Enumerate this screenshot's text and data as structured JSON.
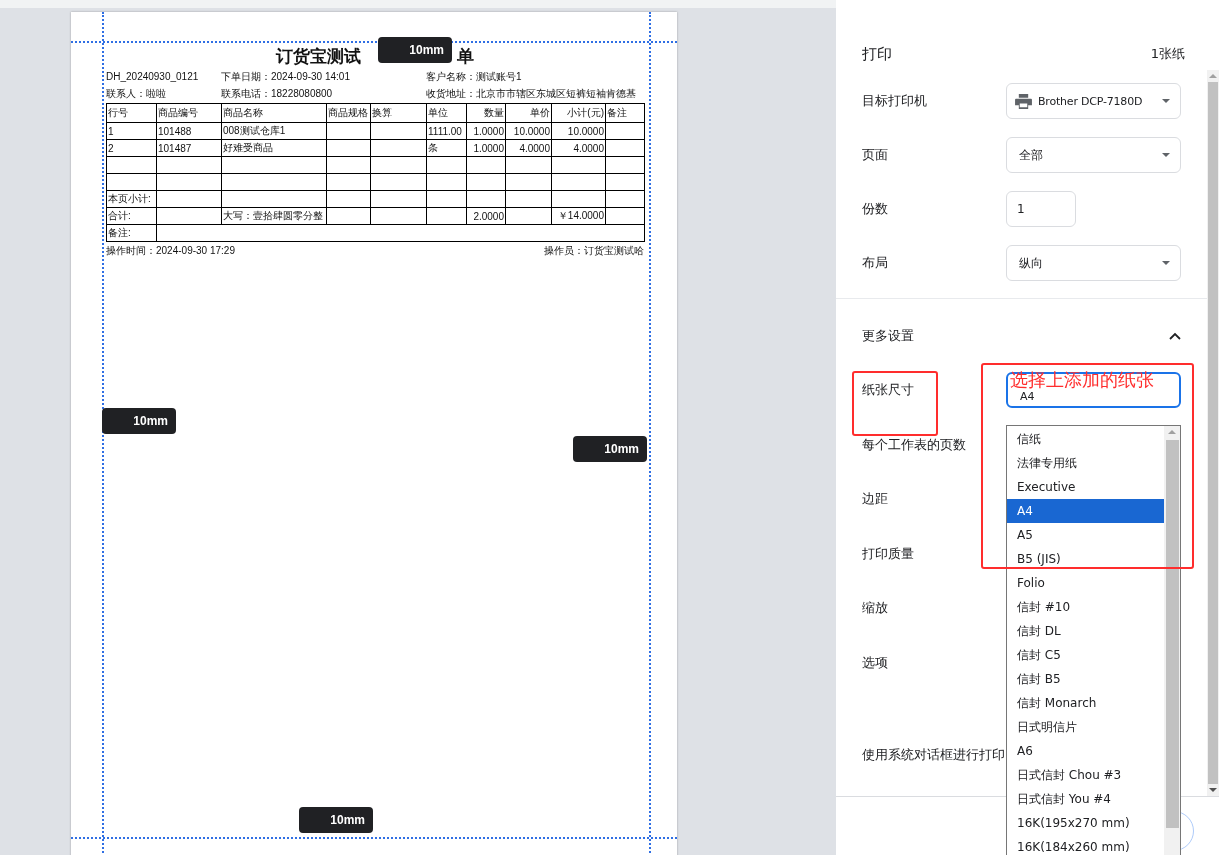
{
  "preview": {
    "title_parts": [
      "订货宝测试",
      "单"
    ],
    "info_rows": [
      [
        "DH_20240930_0121",
        "下单日期：2024-09-30 14:01",
        "客户名称：测试账号1"
      ],
      [
        "联系人：啦啦",
        "联系电话：18228080800",
        "收货地址：北京市市辖区东城区短裤短袖肯德基"
      ]
    ],
    "table": {
      "columns": [
        "行号",
        "商品编号",
        "商品名称",
        "商品规格",
        "换算",
        "单位",
        "数量",
        "单价",
        "小计(元)",
        "备注"
      ],
      "rows": [
        [
          "1",
          "101488",
          "008测试仓库1",
          "",
          "",
          "1111.00",
          "1.0000",
          "10.0000",
          "10.0000",
          ""
        ],
        [
          "2",
          "101487",
          "好难受商品",
          "",
          "",
          "条",
          "1.0000",
          "4.0000",
          "4.0000",
          ""
        ],
        [
          "",
          "",
          "",
          "",
          "",
          "",
          "",
          "",
          "",
          ""
        ],
        [
          "",
          "",
          "",
          "",
          "",
          "",
          "",
          "",
          "",
          ""
        ],
        [
          "本页小计:",
          "",
          "",
          "",
          "",
          "",
          "",
          "",
          "",
          ""
        ],
        [
          "合计:",
          "",
          "大写：壹拾肆圆零分整",
          "",
          "",
          "",
          "2.0000",
          "",
          "￥14.0000",
          ""
        ]
      ],
      "remark_label": "备注:"
    },
    "footer_left": "操作时间：2024-09-30 17:29",
    "footer_right": "操作员：订货宝测试哈",
    "margin_labels": [
      "10mm",
      "10mm",
      "10mm",
      "10mm"
    ]
  },
  "settings": {
    "title": "打印",
    "sheet_count": "1张纸",
    "fields": [
      {
        "kind": "printer",
        "label": "目标打印机",
        "value": "Brother DCP-7180D"
      },
      {
        "kind": "select",
        "label": "页面",
        "value": "全部"
      },
      {
        "kind": "input",
        "label": "份数",
        "value": "1"
      },
      {
        "kind": "select",
        "label": "布局",
        "value": "纵向"
      }
    ],
    "more_settings": {
      "label": "更多设置",
      "expanded": true
    },
    "paper_size": {
      "label": "纸张尺寸",
      "value": "A4",
      "options": [
        {
          "label": "信纸",
          "selected": false
        },
        {
          "label": "法律专用纸",
          "selected": false
        },
        {
          "label": "Executive",
          "selected": false
        },
        {
          "label": "A4",
          "selected": true
        },
        {
          "label": "A5",
          "selected": false
        },
        {
          "label": "B5 (JIS)",
          "selected": false
        },
        {
          "label": "Folio",
          "selected": false
        },
        {
          "label": "信封 #10",
          "selected": false
        },
        {
          "label": "信封 DL",
          "selected": false
        },
        {
          "label": "信封 C5",
          "selected": false
        },
        {
          "label": "信封 B5",
          "selected": false
        },
        {
          "label": "信封 Monarch",
          "selected": false
        },
        {
          "label": "日式明信片",
          "selected": false
        },
        {
          "label": "A6",
          "selected": false
        },
        {
          "label": "日式信封 Chou #3",
          "selected": false
        },
        {
          "label": "日式信封 You #4",
          "selected": false
        },
        {
          "label": "16K(195x270 mm)",
          "selected": false
        },
        {
          "label": "16K(184x260 mm)",
          "selected": false
        }
      ]
    },
    "other_labels": [
      "每个工作表的页数",
      "边距",
      "打印质量",
      "缩放",
      "选项"
    ],
    "system_dialog": "使用系统对话框进行打印"
  },
  "annotation": {
    "note": "选择上添加的纸张"
  }
}
